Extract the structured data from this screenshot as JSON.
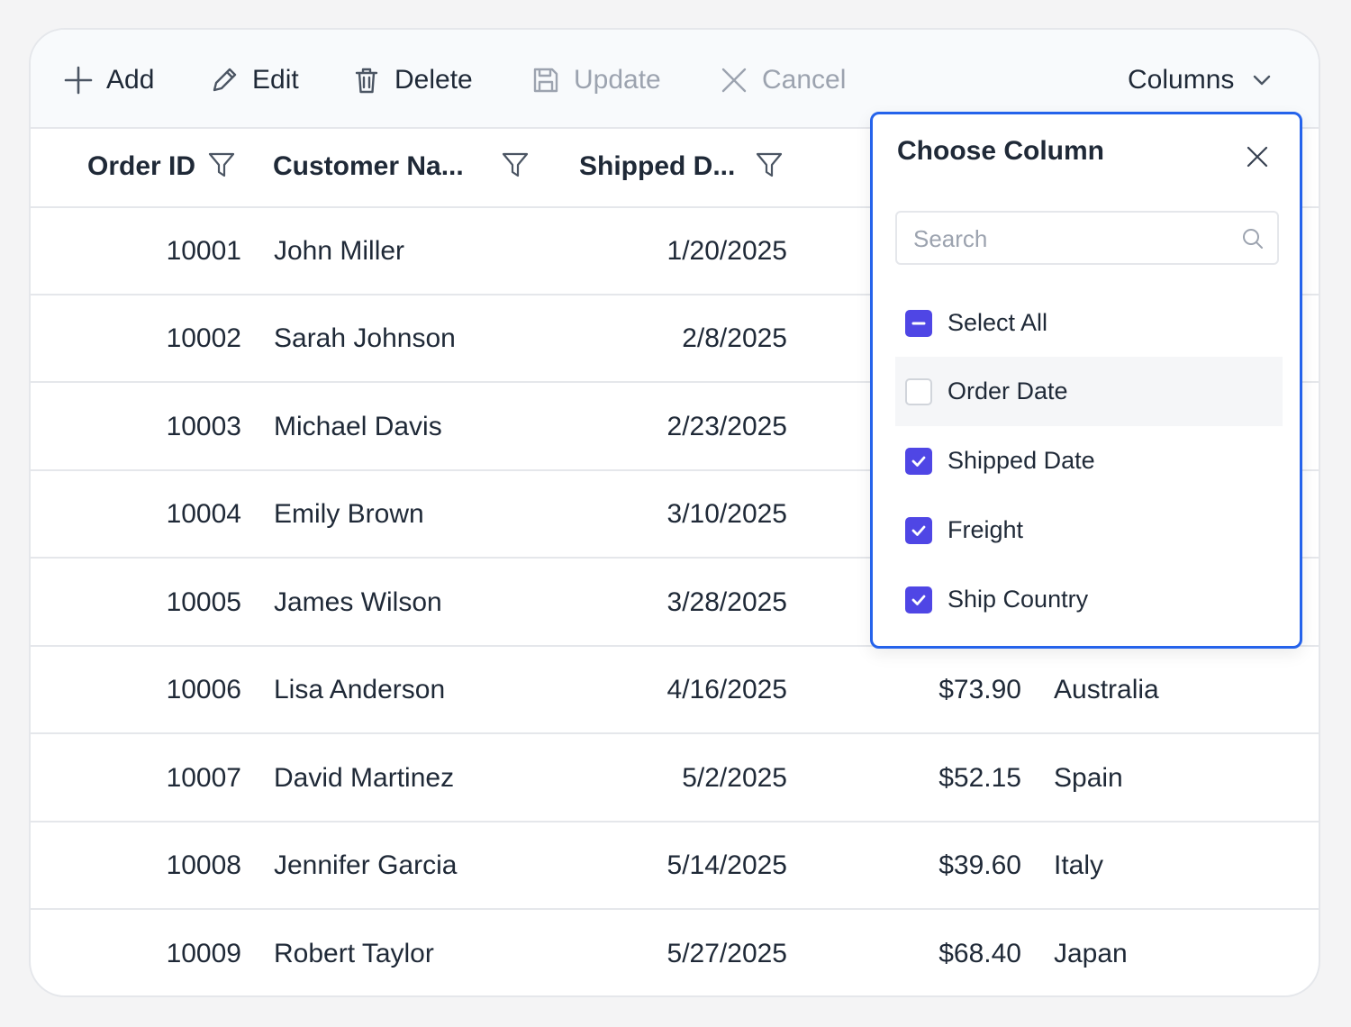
{
  "toolbar": {
    "add_label": "Add",
    "edit_label": "Edit",
    "delete_label": "Delete",
    "update_label": "Update",
    "cancel_label": "Cancel",
    "columns_label": "Columns"
  },
  "grid": {
    "columns": [
      {
        "label": "Order ID"
      },
      {
        "label": "Customer Na..."
      },
      {
        "label": "Shipped D..."
      }
    ],
    "rows": [
      {
        "order_id": "10001",
        "customer": "John Miller",
        "shipped": "1/20/2025",
        "freight": "",
        "country": ""
      },
      {
        "order_id": "10002",
        "customer": "Sarah Johnson",
        "shipped": "2/8/2025",
        "freight": "",
        "country": ""
      },
      {
        "order_id": "10003",
        "customer": "Michael Davis",
        "shipped": "2/23/2025",
        "freight": "",
        "country": ""
      },
      {
        "order_id": "10004",
        "customer": "Emily Brown",
        "shipped": "3/10/2025",
        "freight": "",
        "country": ""
      },
      {
        "order_id": "10005",
        "customer": "James Wilson",
        "shipped": "3/28/2025",
        "freight": "",
        "country": ""
      },
      {
        "order_id": "10006",
        "customer": "Lisa Anderson",
        "shipped": "4/16/2025",
        "freight": "$73.90",
        "country": "Australia"
      },
      {
        "order_id": "10007",
        "customer": "David Martinez",
        "shipped": "5/2/2025",
        "freight": "$52.15",
        "country": "Spain"
      },
      {
        "order_id": "10008",
        "customer": "Jennifer Garcia",
        "shipped": "5/14/2025",
        "freight": "$39.60",
        "country": "Italy"
      },
      {
        "order_id": "10009",
        "customer": "Robert Taylor",
        "shipped": "5/27/2025",
        "freight": "$68.40",
        "country": "Japan"
      }
    ]
  },
  "column_chooser": {
    "title": "Choose Column",
    "search_placeholder": "Search",
    "options": [
      {
        "label": "Select All",
        "state": "partial"
      },
      {
        "label": "Order Date",
        "state": "unchecked"
      },
      {
        "label": "Shipped Date",
        "state": "checked"
      },
      {
        "label": "Freight",
        "state": "checked"
      },
      {
        "label": "Ship Country",
        "state": "checked"
      }
    ]
  },
  "colors": {
    "accent": "#4f46e5",
    "popup_border": "#2563eb",
    "toolbar_bg": "#f8fafc",
    "disabled_text": "#9ca3af"
  }
}
